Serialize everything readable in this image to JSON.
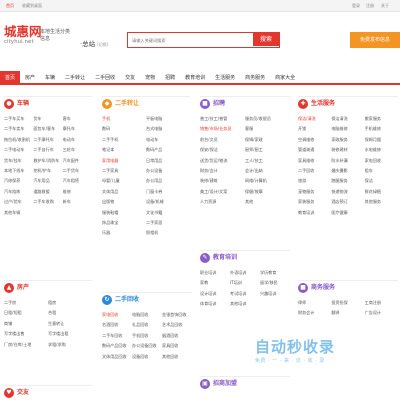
{
  "topbar": {
    "home": "首页",
    "favorite": "收藏到桌面",
    "login": "登录",
    "register": "注册",
    "about": "关于"
  },
  "logo": {
    "cn": "城惠网",
    "en": "cityhui.net"
  },
  "slogan": "本地生活分类信息",
  "city": {
    "name": "·总站",
    "switch": "[切换]"
  },
  "search": {
    "placeholder": "请输入关键词搜索",
    "button": "搜索"
  },
  "publish_button": "免费发布信息",
  "nav": [
    "首页",
    "房产",
    "车辆",
    "二手转让",
    "二手回收",
    "交友",
    "宠物",
    "招聘",
    "教育培训",
    "生活服务",
    "商务服务",
    "商家大全"
  ],
  "sections": {
    "cars": {
      "title": "车辆",
      "items": [
        "二手车买车",
        "货车",
        "客车",
        "二手车卖车",
        "面包车/客车",
        "摩托车",
        "拖拉机/收割机",
        "二手摩托车",
        "电动车",
        "二手电动车",
        "二手自行车",
        "三轮车",
        "货车/挂车",
        "救护车/消防车",
        "汽车配件",
        "本地下线车",
        "挖机/铲车",
        "二手货车",
        "汽修保养",
        "汽车用品",
        "汽车租赁",
        "汽车陪练",
        "道路救援",
        "维修",
        "过户/验车",
        "二手车收购",
        "新车",
        "其他车辆",
        "加长车",
        "其他车"
      ]
    },
    "transfer": {
      "title": "二手转让",
      "items": [
        "手机",
        "平板电脑",
        "数码",
        "台式电脑",
        "二手手机",
        "电动车",
        "笔记本",
        "数码产品",
        "家用电器",
        "日常用品",
        "二手家具",
        "办公设备",
        "母婴/儿童",
        "办公用品",
        "文体用品",
        "门窗卡券",
        "出版物",
        "设备/机械",
        "服装鞋帽",
        "文化书籍",
        "饰品珠宝",
        "二手家居",
        "乐器",
        "照相机",
        "食品饮料",
        "二手设备",
        "其他转让"
      ]
    },
    "recruit": {
      "title": "招聘",
      "items": [
        "普工/技工/普管",
        "服务员/收银员",
        "销售",
        "销售/市场/业务员",
        "客服",
        "前台/文员",
        "保姆/家政",
        "司机/驾驶员",
        "保安",
        "保安/保洁",
        "厨师/厨工",
        "快递员",
        "送货/货运/物流",
        "房产经纪人",
        "工人/技工",
        "财务/会计",
        "美容/美发",
        "会计/出纳",
        "装修/建筑",
        "质检员",
        "网络/计算机",
        "美工/设计/文案",
        "保健/按摩",
        "人力资源",
        "人力/行政",
        "主播",
        "其他"
      ]
    },
    "life": {
      "title": "生活服务",
      "items": [
        "保洁/清洗",
        "保洁清洗",
        "搬家服务",
        "开锁",
        "家电维修",
        "电脑维修",
        "空调维修",
        "手机维修",
        "家政服务",
        "保姆月嫂",
        "管道疏通",
        "装修建材",
        "水电维修",
        "家具维修",
        "防水补漏",
        "家电回收",
        "二手回收",
        "婚庆摄影",
        "租车",
        "旅游",
        "跑腿服务",
        "保洁",
        "宠物服务",
        "快递物流",
        "鲜花绿植",
        "家装服务",
        "酒店预订",
        "其他服务",
        "教育培训",
        "医疗健康"
      ]
    },
    "house": {
      "title": "房产",
      "items": [
        "二手房",
        "租房",
        "新房",
        "日租/短租",
        "合租",
        "商铺",
        "写字楼出售",
        "写字楼出租",
        "厂房/仓库",
        "厂房/仓库/土地",
        "生意转让",
        "土地",
        "求租/求购",
        "二手房求购",
        "其他"
      ]
    },
    "recycle": {
      "title": "二手回收",
      "items": [
        "家电回收",
        "电脑回收",
        "金银首饰回收",
        "名酒回收",
        "礼品回收",
        "艺术品回收",
        "电脑回收",
        "二手车回收",
        "手机回收",
        "烟酒回收",
        "数码产品回收",
        "办公设备回收",
        "文体用品回收",
        "家具回收",
        "设备回收",
        "其他回收"
      ]
    },
    "edu": {
      "title": "教育培训",
      "items": [
        "职业培训",
        "学历教育",
        "外语培训",
        "家教",
        "学历提升",
        "IT培训",
        "留学/移民",
        "设计培训",
        "考试培训",
        "兴趣培训",
        "体育培训",
        "其他培训",
        "早教",
        "驾校"
      ]
    },
    "biz": {
      "title": "商务服务",
      "items": [
        "律师",
        "投资担保",
        "工商注册",
        "财务会计",
        "翻译",
        "广告设计",
        "保险",
        "印刷/包装",
        "快递",
        "物流",
        "网站建设",
        "设备维修",
        "广告传媒",
        "展会服务",
        "其他"
      ]
    },
    "dating": {
      "title": "交友"
    },
    "join": {
      "title": "招商加盟"
    }
  },
  "watermark": {
    "main": "自动秒收录",
    "sub": "免费 · 一 · 来 · 访 · 收 · 录"
  },
  "colors": {
    "brand": "#e3362e",
    "orange": "#f39423",
    "green": "#7bb22c",
    "purple": "#8a5cc7",
    "blue": "#2b8bd9"
  }
}
